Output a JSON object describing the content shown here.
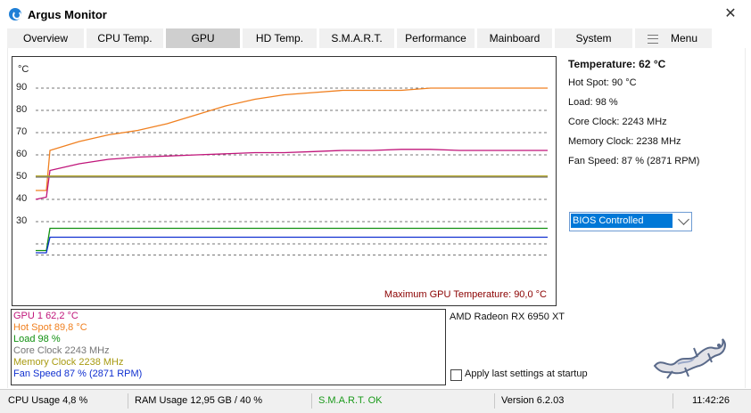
{
  "window": {
    "title": "Argus Monitor",
    "close_glyph": "✕"
  },
  "tabs": [
    {
      "label": "Overview"
    },
    {
      "label": "CPU Temp."
    },
    {
      "label": "GPU",
      "active": true
    },
    {
      "label": "HD Temp."
    },
    {
      "label": "S.M.A.R.T."
    },
    {
      "label": "Performance"
    },
    {
      "label": "Mainboard"
    },
    {
      "label": "System"
    },
    {
      "label": "Menu"
    }
  ],
  "graph": {
    "unit": "°C",
    "y_ticks": [
      "90",
      "80",
      "70",
      "60",
      "50",
      "40",
      "30"
    ],
    "max_label": "Maximum GPU Temperature: 90,0 °C"
  },
  "chart_data": {
    "type": "line",
    "yunit": "°C",
    "ylim": [
      15,
      95
    ],
    "y_ticks": [
      90,
      80,
      70,
      60,
      50,
      40,
      30
    ],
    "grid": true,
    "series": [
      {
        "name": "Hot Spot",
        "color": "#f08020",
        "values": [
          44,
          44,
          62,
          66,
          69,
          71,
          74,
          78,
          82,
          85,
          87,
          88,
          89,
          89,
          89,
          90,
          90,
          90,
          90,
          90
        ]
      },
      {
        "name": "GPU 1",
        "color": "#c0157a",
        "values": [
          40,
          41,
          53,
          56,
          58,
          59,
          59.5,
          60,
          60.5,
          61,
          61,
          61.5,
          62,
          62,
          62.5,
          62.5,
          62,
          62,
          62,
          62
        ]
      },
      {
        "name": "Memory Clock",
        "color": "#b3a51f",
        "values": [
          50.5,
          50.5,
          50.5,
          50.5,
          50.5,
          50.5,
          50.5,
          50.5,
          50.5,
          50.5,
          50.5,
          50.5,
          50.5,
          50.5,
          50.5,
          50.5,
          50.5,
          50.5,
          50.5,
          50.5
        ]
      },
      {
        "name": "Core Clock",
        "color": "#777777",
        "values": [
          50,
          50,
          50,
          50,
          50,
          50,
          50,
          50,
          50,
          50,
          50,
          50,
          50,
          50,
          50,
          50,
          50,
          50,
          50,
          50
        ]
      },
      {
        "name": "Load",
        "color": "#109010",
        "values": [
          17,
          17,
          27,
          27,
          27,
          27,
          27,
          27,
          27,
          27,
          27,
          27,
          27,
          27,
          27,
          27,
          27,
          27,
          27,
          27
        ]
      },
      {
        "name": "Fan Speed",
        "color": "#1030d0",
        "values": [
          16,
          16,
          23,
          23,
          23,
          23,
          23,
          23,
          23,
          23,
          23,
          23,
          23,
          23,
          23,
          23,
          23,
          23,
          23,
          23
        ]
      }
    ]
  },
  "info": {
    "temperature": "Temperature: 62 °C",
    "hot_spot": "Hot Spot: 90 °C",
    "load": "Load: 98 %",
    "core_clock": "Core Clock: 2243 MHz",
    "memory_clock": "Memory Clock: 2238 MHz",
    "fan_speed": "Fan Speed: 87 % (2871 RPM)"
  },
  "fan_mode": {
    "selected": "BIOS Controlled"
  },
  "legend": [
    {
      "text": "GPU 1 62,2 °C",
      "color": "#c0157a"
    },
    {
      "text": "Hot Spot 89,8 °C",
      "color": "#f08020"
    },
    {
      "text": "Load 98 %",
      "color": "#109010"
    },
    {
      "text": "Core Clock 2243 MHz",
      "color": "#777777"
    },
    {
      "text": "Memory Clock 2238 MHz",
      "color": "#a89a10"
    },
    {
      "text": "Fan Speed 87 % (2871 RPM)",
      "color": "#1030d0"
    }
  ],
  "gpu_name": "AMD Radeon RX 6950 XT",
  "apply_settings": {
    "label": "Apply last settings at startup",
    "checked": false
  },
  "status": {
    "cpu_usage": "CPU Usage 4,8 %",
    "ram_usage": "RAM Usage 12,95 GB / 40 %",
    "smart": "S.M.A.R.T. OK",
    "version": "Version 6.2.03",
    "time": "11:42:26",
    "smart_color": "#1a9a1a"
  }
}
